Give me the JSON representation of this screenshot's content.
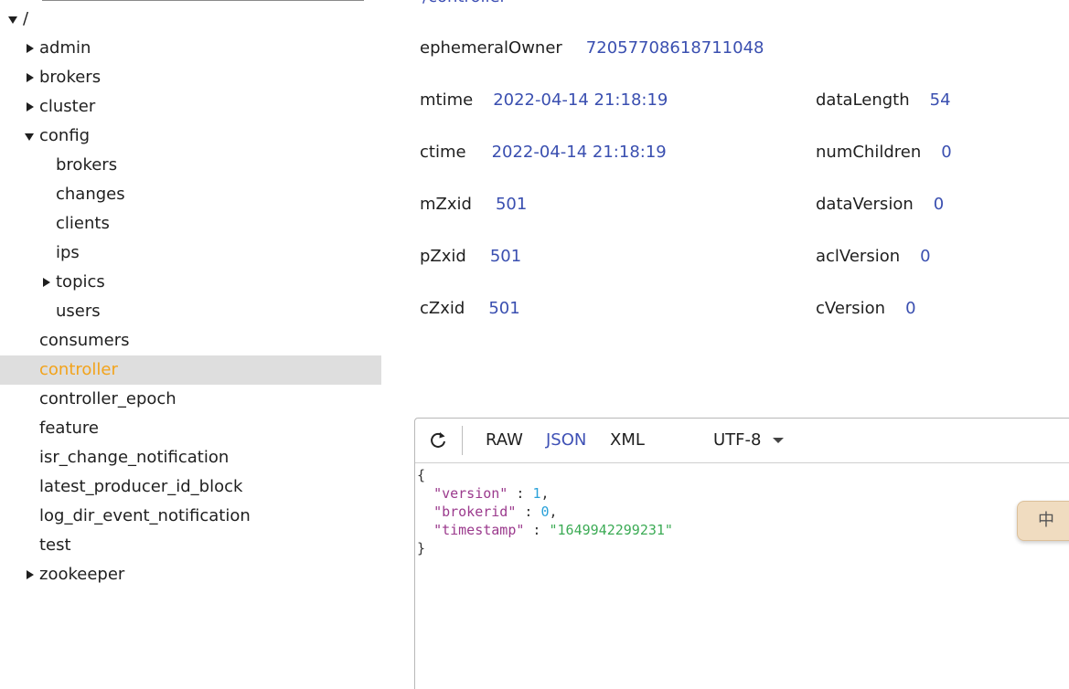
{
  "tree": {
    "root": "/",
    "items": [
      {
        "label": "admin",
        "expander": "collapsed"
      },
      {
        "label": "brokers",
        "expander": "collapsed"
      },
      {
        "label": "cluster",
        "expander": "collapsed"
      },
      {
        "label": "config",
        "expander": "expanded"
      },
      {
        "label": "brokers",
        "expander": "none"
      },
      {
        "label": "changes",
        "expander": "none"
      },
      {
        "label": "clients",
        "expander": "none"
      },
      {
        "label": "ips",
        "expander": "none"
      },
      {
        "label": "topics",
        "expander": "collapsed"
      },
      {
        "label": "users",
        "expander": "none"
      },
      {
        "label": "consumers",
        "expander": "none"
      },
      {
        "label": "controller",
        "expander": "none",
        "selected": true
      },
      {
        "label": "controller_epoch",
        "expander": "none"
      },
      {
        "label": "feature",
        "expander": "none"
      },
      {
        "label": "isr_change_notification",
        "expander": "none"
      },
      {
        "label": "latest_producer_id_block",
        "expander": "none"
      },
      {
        "label": "log_dir_event_notification",
        "expander": "none"
      },
      {
        "label": "test",
        "expander": "none"
      },
      {
        "label": "zookeeper",
        "expander": "collapsed"
      }
    ]
  },
  "details": {
    "path": "/controller",
    "ephemeralOwner": {
      "key": "ephemeralOwner",
      "value": "72057708618711048"
    },
    "mtime": {
      "key": "mtime",
      "value": "2022-04-14 21:18:19"
    },
    "ctime": {
      "key": "ctime",
      "value": "2022-04-14 21:18:19"
    },
    "mZxid": {
      "key": "mZxid",
      "value": "501"
    },
    "pZxid": {
      "key": "pZxid",
      "value": "501"
    },
    "cZxid": {
      "key": "cZxid",
      "value": "501"
    },
    "dataLength": {
      "key": "dataLength",
      "value": "54"
    },
    "numChildren": {
      "key": "numChildren",
      "value": "0"
    },
    "dataVersion": {
      "key": "dataVersion",
      "value": "0"
    },
    "aclVersion": {
      "key": "aclVersion",
      "value": "0"
    },
    "cVersion": {
      "key": "cVersion",
      "value": "0"
    }
  },
  "viewer": {
    "formats": [
      "RAW",
      "JSON",
      "XML"
    ],
    "active_format": "JSON",
    "encoding": "UTF-8",
    "content": {
      "open": "{",
      "close": "}",
      "fields": [
        {
          "key": "\"version\"",
          "value": "1",
          "type": "num"
        },
        {
          "key": "\"brokerid\"",
          "value": "0",
          "type": "num"
        },
        {
          "key": "\"timestamp\"",
          "value": "\"1649942299231\"",
          "type": "str"
        }
      ]
    }
  },
  "ime": {
    "label": "中"
  },
  "colors": {
    "accent": "#3f51b5",
    "selected_text": "#f2a31b",
    "selected_bg": "#dedede"
  }
}
